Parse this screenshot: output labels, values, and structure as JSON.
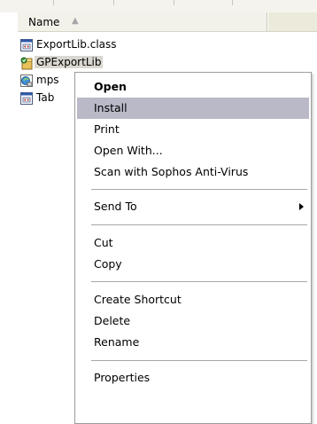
{
  "header": {
    "name_label": "Name",
    "sort_glyph": "▲"
  },
  "files": [
    {
      "name": "ExportLib.class",
      "icon": "class-file-icon",
      "selected": false
    },
    {
      "name": "GPExportLib",
      "icon": "installer-file-icon",
      "selected": true
    },
    {
      "name": "mps",
      "icon": "script-file-icon",
      "selected": false
    },
    {
      "name": "Tab",
      "icon": "class-file-icon",
      "selected": false
    }
  ],
  "context_menu": {
    "open": "Open",
    "install": "Install",
    "print": "Print",
    "open_with": "Open With...",
    "scan": "Scan with Sophos Anti-Virus",
    "send_to": "Send To",
    "cut": "Cut",
    "copy": "Copy",
    "create_shortcut": "Create Shortcut",
    "delete": "Delete",
    "rename": "Rename",
    "properties": "Properties"
  },
  "colors": {
    "menu_hover": "#b9b9c8",
    "header_bg": "#ebeadb",
    "selection": "#d9d7cf"
  }
}
